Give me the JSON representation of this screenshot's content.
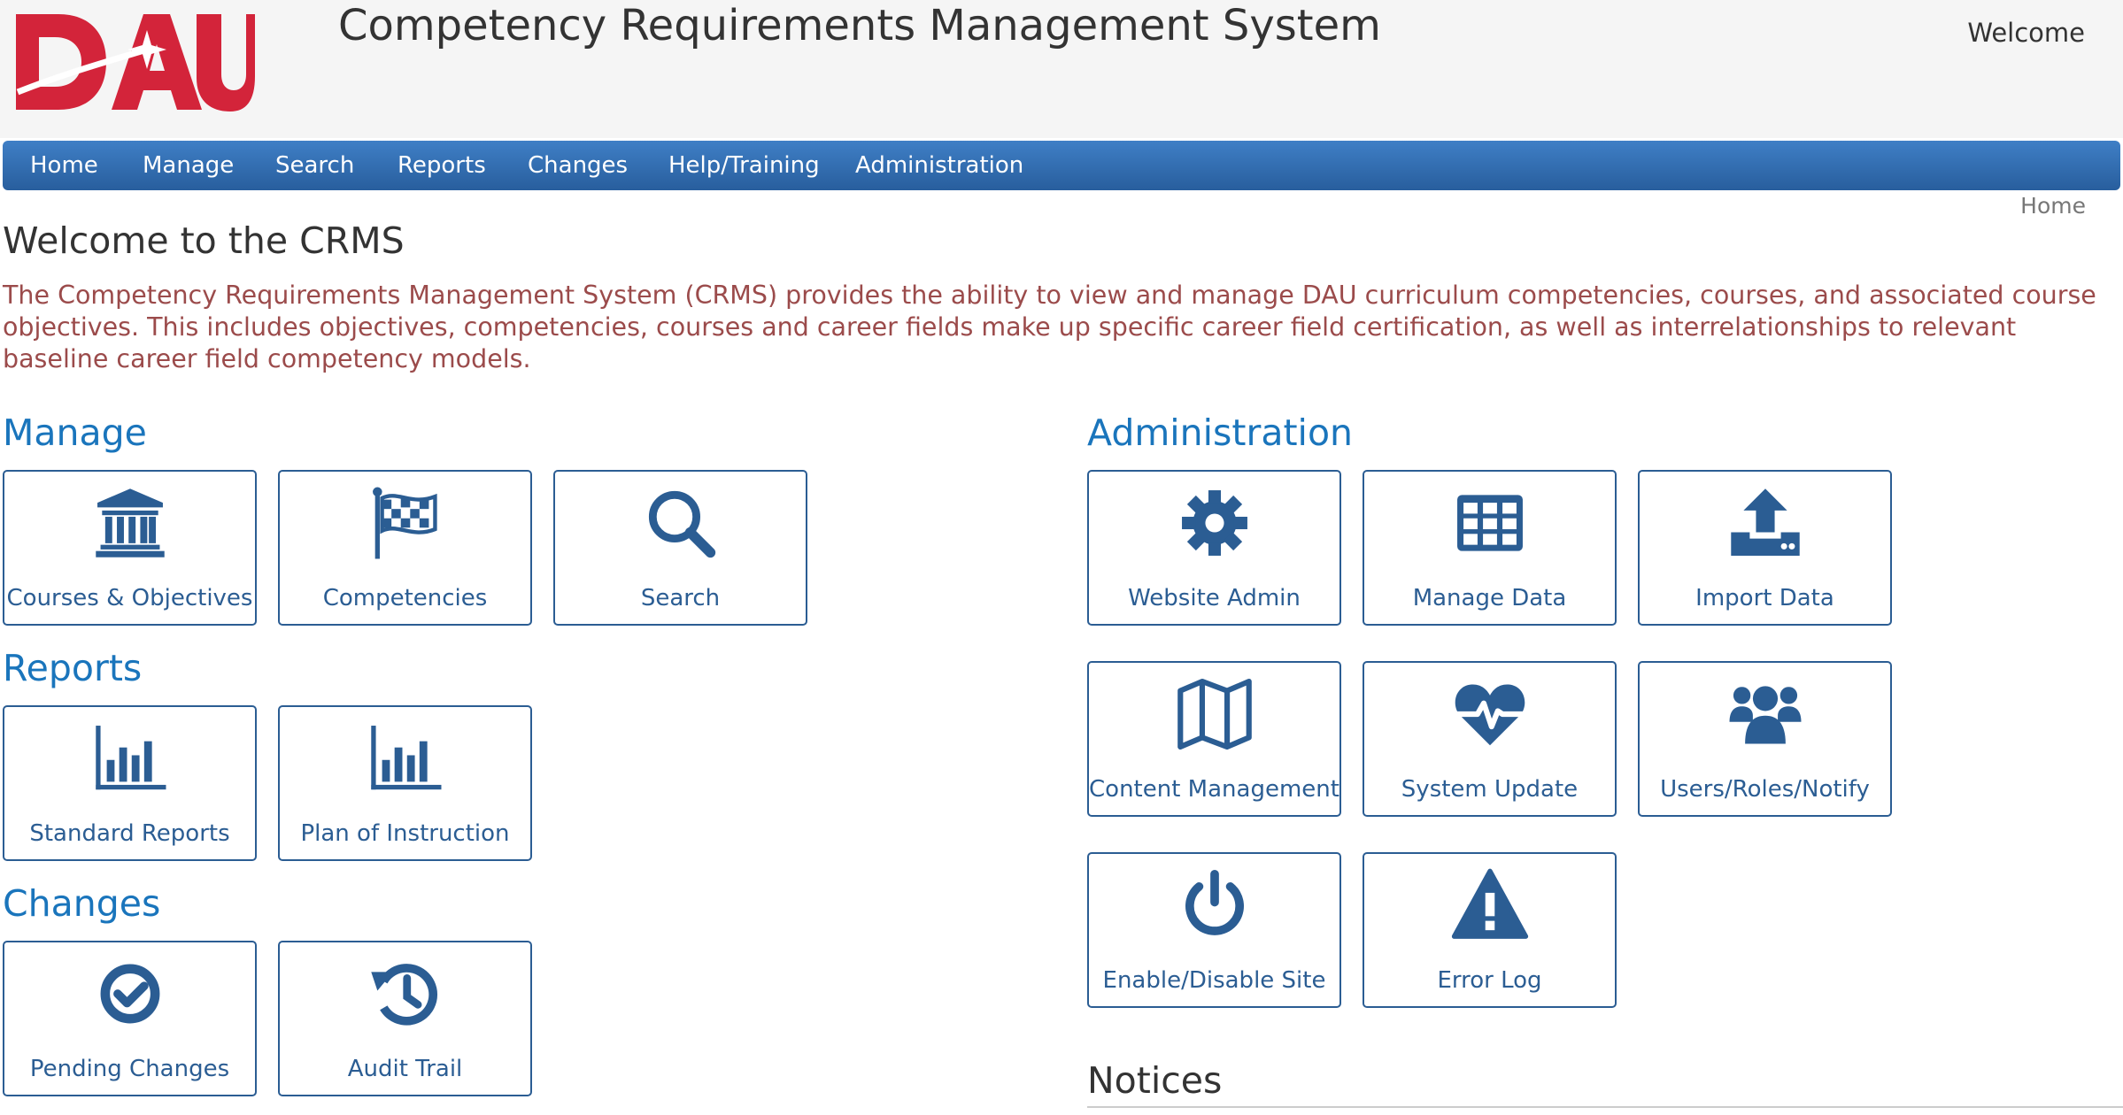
{
  "header": {
    "app_title": "Competency Requirements Management System",
    "welcome": "Welcome",
    "logo_text": "DAU"
  },
  "nav": {
    "items": [
      {
        "label": "Home"
      },
      {
        "label": "Manage"
      },
      {
        "label": "Search"
      },
      {
        "label": "Reports"
      },
      {
        "label": "Changes"
      },
      {
        "label": "Help/Training"
      },
      {
        "label": "Administration"
      }
    ]
  },
  "breadcrumb": "Home",
  "page": {
    "title": "Welcome to the CRMS",
    "intro": "The Competency Requirements Management System (CRMS) provides the ability to view and manage DAU curriculum competencies, courses, and associated course objectives. This includes objectives, competencies, courses and career fields make up specific career field certification, as well as interrelationships to relevant baseline career field competency models."
  },
  "sections": {
    "manage": {
      "title": "Manage",
      "tiles": [
        {
          "label": "Courses & Objectives",
          "icon": "institution-icon"
        },
        {
          "label": "Competencies",
          "icon": "flag-checkered-icon"
        },
        {
          "label": "Search",
          "icon": "search-icon"
        }
      ]
    },
    "reports": {
      "title": "Reports",
      "tiles": [
        {
          "label": "Standard Reports",
          "icon": "bar-chart-icon"
        },
        {
          "label": "Plan of Instruction",
          "icon": "bar-chart-icon"
        }
      ]
    },
    "changes": {
      "title": "Changes",
      "tiles": [
        {
          "label": "Pending Changes",
          "icon": "check-circle-icon"
        },
        {
          "label": "Audit Trail",
          "icon": "history-icon"
        }
      ]
    },
    "administration": {
      "title": "Administration",
      "tiles": [
        {
          "label": "Website Admin",
          "icon": "gear-icon"
        },
        {
          "label": "Manage Data",
          "icon": "table-icon"
        },
        {
          "label": "Import Data",
          "icon": "upload-icon"
        },
        {
          "label": "Content Management",
          "icon": "map-icon"
        },
        {
          "label": "System Update",
          "icon": "heartbeat-icon"
        },
        {
          "label": "Users/Roles/Notify",
          "icon": "users-icon"
        },
        {
          "label": "Enable/Disable Site",
          "icon": "power-icon"
        },
        {
          "label": "Error Log",
          "icon": "warning-icon"
        }
      ]
    },
    "notices": {
      "title": "Notices"
    }
  },
  "colors": {
    "nav_bg": "#336fb3",
    "accent": "#1a75bc",
    "tile_border": "#2b5d93",
    "intro_text": "#9b4b4b",
    "logo_red": "#d3243a"
  }
}
